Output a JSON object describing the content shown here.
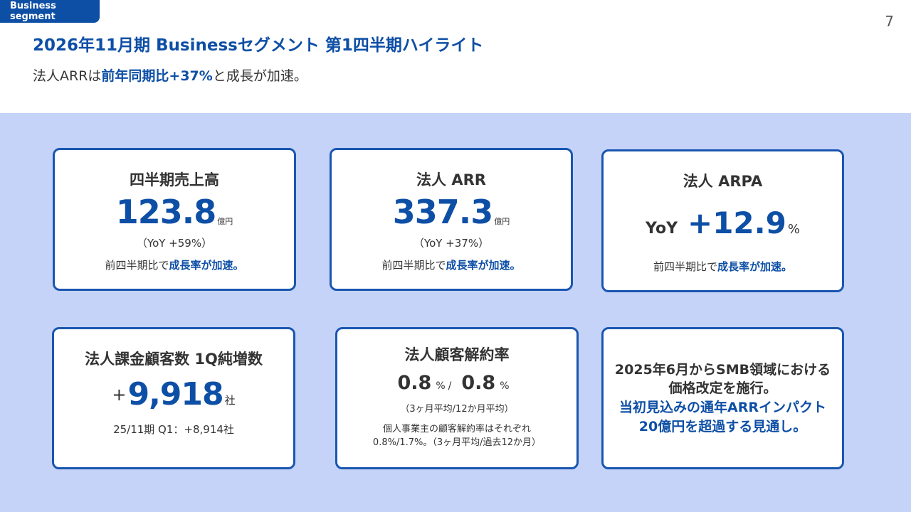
{
  "header": {
    "segment_tag": "Business segment",
    "page_number": "7",
    "title": "2026年11月期 Businessセグメント 第1四半期ハイライト",
    "subtitle_pre": "法人ARRは",
    "subtitle_highlight": "前年同期比+37%",
    "subtitle_post": "と成長が加速。"
  },
  "cards": {
    "revenue": {
      "title": "四半期売上高",
      "value": "123.8",
      "unit": "億円",
      "yoy": "（YoY +59%）",
      "note_pre": "前四半期比で",
      "note_highlight": "成長率が加速。"
    },
    "arr": {
      "title": "法人 ARR",
      "value": "337.3",
      "unit": "億円",
      "yoy": "（YoY +37%）",
      "note_pre": "前四半期比で",
      "note_highlight": "成長率が加速。"
    },
    "arpa": {
      "title": "法人 ARPA",
      "label": "YoY",
      "value": "+12.9",
      "unit": "%",
      "note_pre": "前四半期比で",
      "note_highlight": "成長率が加速。"
    },
    "customers": {
      "title": "法人課金顧客数 1Q純増数",
      "prefix": "+",
      "value": "9,918",
      "unit": "社",
      "note": "25/11期 Q1：+8,914社"
    },
    "churn": {
      "title": "法人顧客解約率",
      "value_3m": "0.8",
      "value_12m": "0.8",
      "unit": "%",
      "separator": "/",
      "period_note": "（3ヶ月平均/12か月平均）",
      "detail_line1": "個人事業主の顧客解約率はそれぞれ",
      "detail_line2": "0.8%/1.7%。（3ヶ月平均/過去12か月）"
    },
    "pricing": {
      "line1": "2025年6月からSMB領域における",
      "line2": "価格改定を施行。",
      "line3": "当初見込みの通年ARRインパクト",
      "line4": "20億円を超過する見通し。"
    }
  },
  "colors": {
    "brand_blue": "#0e4fa6",
    "band_background": "#c5d3f8",
    "card_border": "#1a56b0"
  }
}
